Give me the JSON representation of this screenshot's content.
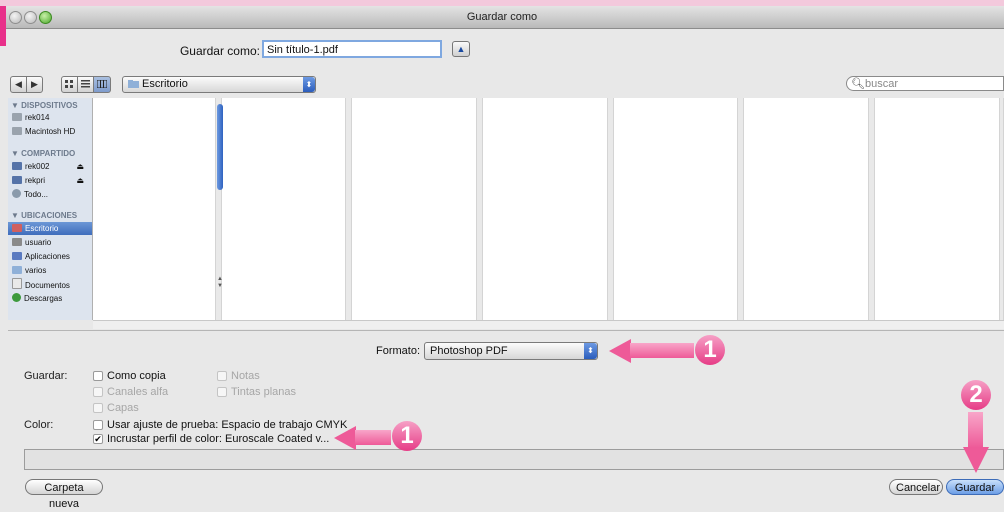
{
  "window": {
    "title": "Guardar como"
  },
  "save_as": {
    "label": "Guardar como:",
    "filename": "Sin título-1.pdf"
  },
  "toolbar": {
    "back_glyph": "◀",
    "forward_glyph": "▶",
    "view_icons": [
      "icon-view-icon",
      "list-view-icon",
      "column-view-icon"
    ],
    "location": "Escritorio",
    "search_placeholder": "buscar"
  },
  "sidebar": {
    "sections": [
      {
        "title": "▼ DISPOSITIVOS",
        "items": [
          {
            "label": "rek014",
            "icon": "computer-icon",
            "color": "#9aa3ad"
          },
          {
            "label": "Macintosh HD",
            "icon": "disk-icon",
            "color": "#9aa3ad"
          }
        ]
      },
      {
        "title": "▼ COMPARTIDO",
        "items": [
          {
            "label": "rek002",
            "icon": "server-icon",
            "color": "#5573a8",
            "eject": "⏏"
          },
          {
            "label": "rekpri",
            "icon": "server-icon",
            "color": "#5573a8",
            "eject": "⏏"
          },
          {
            "label": "Todo...",
            "icon": "network-icon",
            "color": "#8a9aab"
          }
        ]
      },
      {
        "title": "▼ UBICACIONES",
        "items": [
          {
            "label": "Escritorio",
            "icon": "desktop-icon",
            "color": "#d06060",
            "selected": true
          },
          {
            "label": "usuario",
            "icon": "home-icon",
            "color": "#8a8a8a"
          },
          {
            "label": "Aplicaciones",
            "icon": "applications-icon",
            "color": "#5a7ac0"
          },
          {
            "label": "varios",
            "icon": "folder-icon",
            "color": "#8fb0d8"
          },
          {
            "label": "Documentos",
            "icon": "document-icon",
            "color": "#cfcfcf"
          },
          {
            "label": "Descargas",
            "icon": "download-icon",
            "color": "#3d9a3d"
          }
        ]
      }
    ]
  },
  "options": {
    "format_label": "Formato:",
    "format_value": "Photoshop PDF",
    "save_label": "Guardar:",
    "save_options": [
      {
        "label": "Como copia",
        "checked": false,
        "enabled": true
      },
      {
        "label": "Notas",
        "checked": false,
        "enabled": false
      },
      {
        "label": "Canales alfa",
        "checked": false,
        "enabled": false
      },
      {
        "label": "Tintas planas",
        "checked": false,
        "enabled": false
      },
      {
        "label": "Capas",
        "checked": false,
        "enabled": false
      }
    ],
    "color_label": "Color:",
    "color_options": [
      {
        "label": "Usar ajuste de prueba: Espacio de trabajo CMYK",
        "checked": false,
        "enabled": true
      },
      {
        "label": "Incrustar perfil de color: Euroscale Coated v...",
        "checked": true,
        "enabled": true
      }
    ]
  },
  "buttons": {
    "new_folder": "Carpeta nueva",
    "cancel": "Cancelar",
    "save": "Guardar"
  },
  "annotations": {
    "badge_1": "1",
    "badge_2": "2",
    "accent_color": "#ea4c92"
  }
}
